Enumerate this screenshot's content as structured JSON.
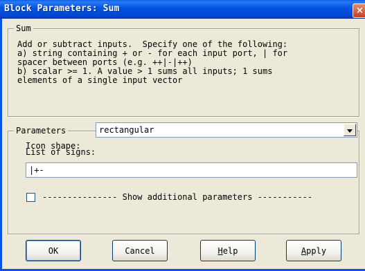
{
  "window": {
    "title": "Block Parameters: Sum",
    "close_glyph": "×"
  },
  "description_group": {
    "legend": "Sum",
    "text": "Add or subtract inputs.  Specify one of the following:\na) string containing + or - for each input port, | for\nspacer between ports (e.g. ++|-|++)\nb) scalar >= 1. A value > 1 sums all inputs; 1 sums\nelements of a single input vector"
  },
  "parameters_group": {
    "legend": "Parameters",
    "icon_shape_label": "Icon shape:",
    "icon_shape_value": "rectangular",
    "list_of_signs_label": "List of signs:",
    "list_of_signs_value": "|+-",
    "show_additional_label": "--------------- Show additional parameters -----------",
    "show_additional_checked": false
  },
  "buttons": {
    "ok": "OK",
    "cancel": "Cancel",
    "help_prefix": "H",
    "help_rest": "elp",
    "apply_prefix": "A",
    "apply_rest": "pply"
  },
  "colors": {
    "titlebar": "#0054e3",
    "dialog_bg": "#ece9d8",
    "close_button": "#c84120"
  }
}
